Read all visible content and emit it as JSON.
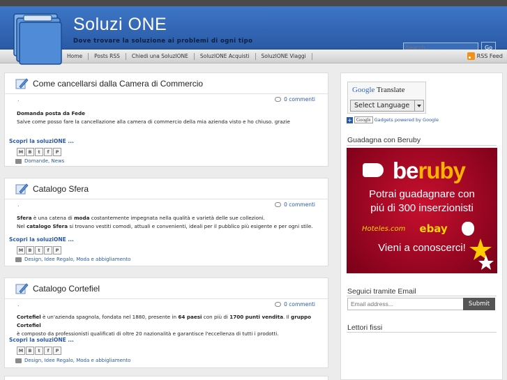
{
  "header": {
    "title": "Soluzi ONE",
    "tagline": "Dove trovare la soluzione ai problemi di ogni tipo",
    "search_placeholder": "Search...",
    "search_button": "Go"
  },
  "nav": {
    "items": [
      "Home",
      "Posts RSS",
      "Chiedi una SoluzIONE",
      "SoluzIONE Acquisti",
      "SoluzIONE Viaggi"
    ],
    "rss_feed": "RSS Feed"
  },
  "posts": [
    {
      "title": "Come cancellarsi dalla Camera di Commercio",
      "meta": ".",
      "comments": "0 commenti",
      "body_line1": "Domanda posta da Fede",
      "body_line2": "Salve come posso fare la cancellazione alla camera di commercio  della mia azienda visto e ho chiuso. grazie",
      "scopri": "Scopri la soluziONE ...",
      "labels": "Domande, News"
    },
    {
      "title": "Catalogo Sfera",
      "meta": ".",
      "comments": "0 commenti",
      "body_line1_b": "Sfera",
      "body_line1_a": " è una catena di ",
      "body_line1_c": "moda",
      "body_line1_d": " costantemente impegnata nella qualità e varietà delle sue collezioni.",
      "body_line2_a": "Nel ",
      "body_line2_b": "catalogo Sfera",
      "body_line2_c": " si trovano vestiti comodi, attuali e convenienti, ideali per il pubblico più esigente e per ogni stile.",
      "scopri": "Scopri la soluziONE ...",
      "labels": "Design, Idee Regalo, Moda e abbigliamento"
    },
    {
      "title": "Catalogo Cortefiel",
      "meta": ".",
      "comments": "0 commenti",
      "body_line1_a": "Cortefiel",
      "body_line1_b": " è un'azienda spagnola, fondata nel 1880, presente in ",
      "body_line1_c": "64 paesi",
      "body_line1_d": " con più di ",
      "body_line1_e": "1700 punti vendita",
      "body_line1_f": ". Il ",
      "body_line1_g": "gruppo Cortefiel",
      "body_line2": "è composto da professionisti qualificati di oltre 20 nazionalità e garantisce l'eccellenza di tutti i prodotti.",
      "scopri": "Scopri la soluziONE ...",
      "labels": "Design, Idee Regalo, Moda e abbigliamento"
    }
  ],
  "share_buttons": [
    "M",
    "B",
    "t",
    "f",
    "P"
  ],
  "sidebar": {
    "translate_google": "Google",
    "translate_title": "Translate",
    "select_language": "Select Language",
    "gadgets_google": "Google",
    "gadgets_text": "Gadgets powered by Google",
    "beruby_title": "Guadagna con Beruby",
    "banner": {
      "brand_a": "be",
      "brand_b": "ruby",
      "line1": "Potrai guadagnare con",
      "line2": "piú di 300 inserzionisti",
      "logo1": "Hoteles.com",
      "logo2": "ebay",
      "cta": "Vieni a conoscerci!"
    },
    "email_title": "Seguici tramite Email",
    "email_placeholder": "Email address...",
    "email_submit": "Submit",
    "followers_title": "Lettori fissi"
  },
  "colors": {
    "header_blue": "#2a5aa6",
    "link_blue": "#2a5aa6",
    "banner_red": "#c8102e"
  }
}
